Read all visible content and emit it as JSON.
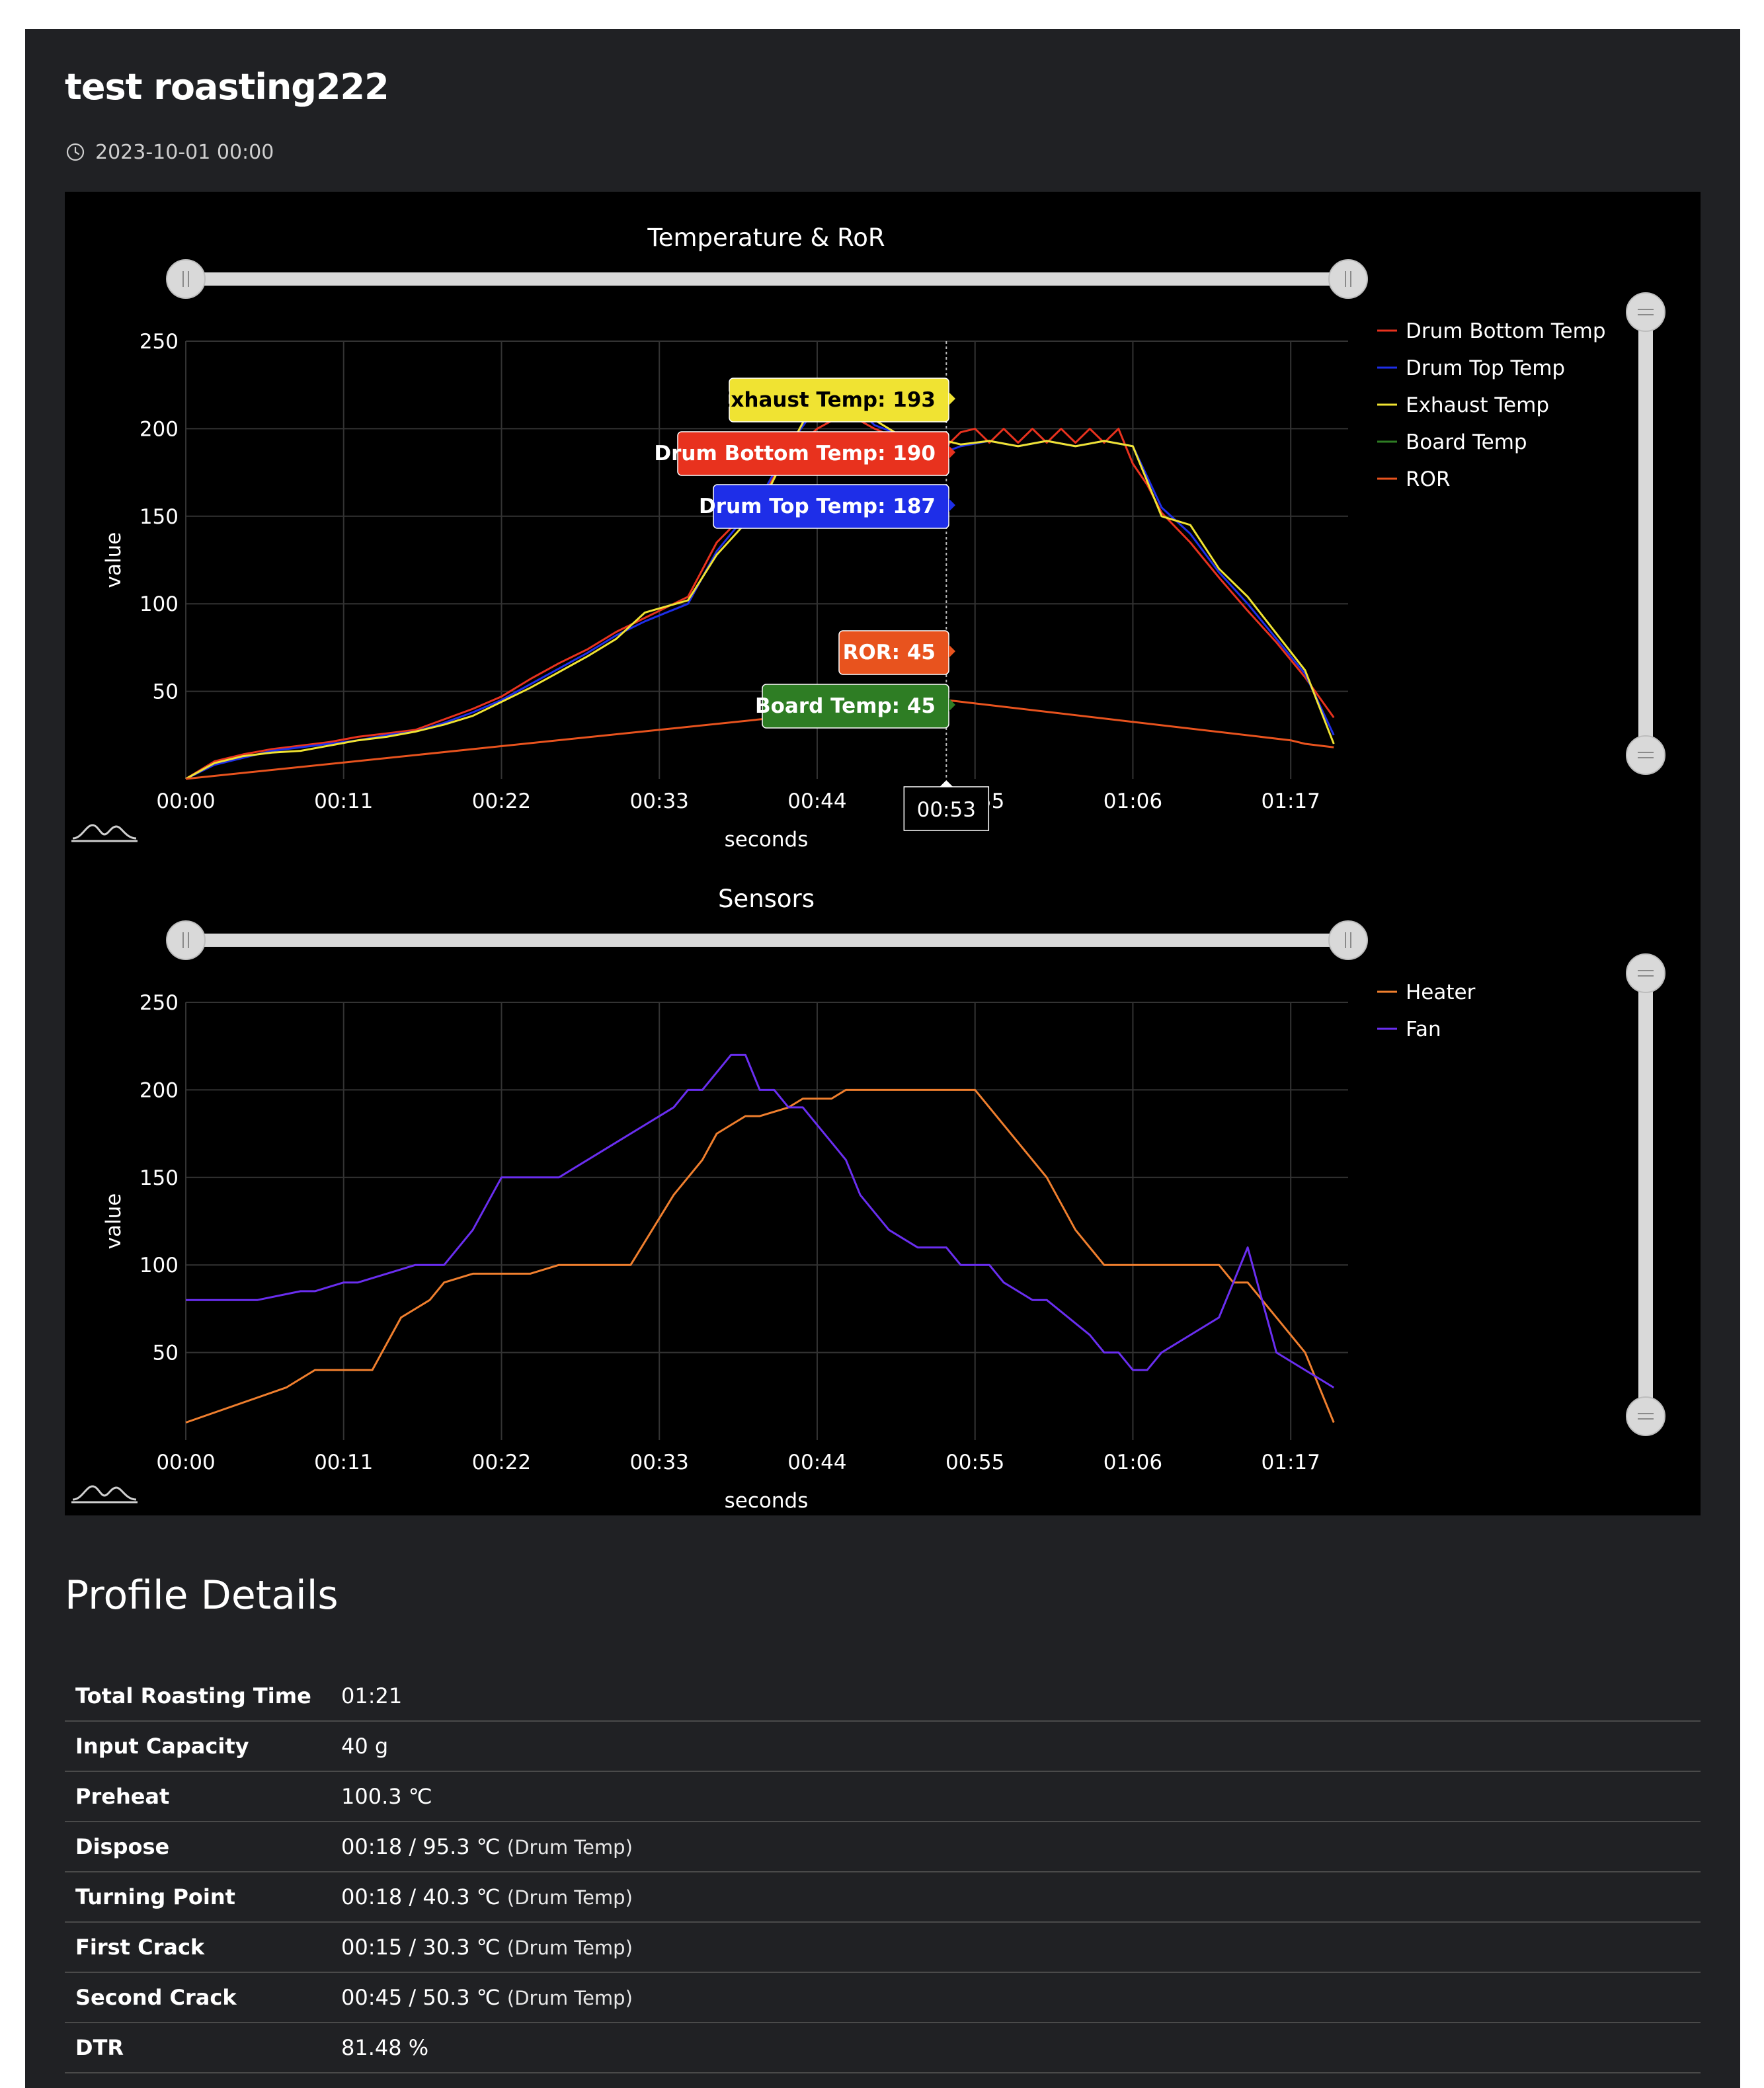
{
  "page": {
    "title": "test roasting222",
    "date": "2023-10-01 00:00",
    "icons": {
      "date": "clock-icon",
      "zoom_reset": "mountain-chart-icon",
      "range_handle": "grip-handle-icon"
    }
  },
  "colors": {
    "page_bg": "#202124",
    "chart_bg": "#000000",
    "grid": "#333333",
    "slider": "#d9d9d9",
    "drum_bottom": "#e8321e",
    "drum_top": "#1e2ee8",
    "exhaust": "#f0e332",
    "board": "#2e7d24",
    "ror": "#e8531e",
    "heater": "#f07f2e",
    "fan": "#6a2ef0"
  },
  "chart_data": [
    {
      "type": "line",
      "title": "Temperature & RoR",
      "xlabel": "seconds",
      "ylabel": "value",
      "xlim": [
        0,
        81
      ],
      "ylim": [
        0,
        250
      ],
      "x_ticks": [
        "00:00",
        "00:11",
        "00:22",
        "00:33",
        "00:44",
        "00:55",
        "01:06",
        "01:17"
      ],
      "y_ticks": [
        "50",
        "100",
        "150",
        "200",
        "250"
      ],
      "grid": true,
      "legend_position": "right",
      "series": [
        {
          "name": "Drum Bottom Temp",
          "color": "#e8321e",
          "x": [
            0,
            2,
            4,
            6,
            8,
            10,
            12,
            14,
            16,
            18,
            20,
            22,
            24,
            26,
            28,
            30,
            32,
            35,
            37,
            40,
            42,
            44,
            46,
            48,
            50,
            52,
            53,
            54,
            55,
            56,
            57,
            58,
            59,
            60,
            61,
            62,
            63,
            64,
            65,
            66,
            67,
            68,
            70,
            72,
            74,
            76,
            78,
            80
          ],
          "y": [
            0,
            10,
            14,
            17,
            19,
            21,
            24,
            26,
            28,
            34,
            40,
            47,
            57,
            66,
            74,
            84,
            92,
            104,
            135,
            160,
            185,
            200,
            209,
            200,
            193,
            190,
            190,
            198,
            200,
            192,
            200,
            192,
            200,
            192,
            200,
            192,
            200,
            192,
            200,
            180,
            168,
            152,
            135,
            115,
            96,
            78,
            58,
            35
          ]
        },
        {
          "name": "Drum Top Temp",
          "color": "#1e2ee8",
          "x": [
            0,
            2,
            4,
            6,
            8,
            10,
            12,
            14,
            16,
            18,
            20,
            22,
            24,
            26,
            28,
            30,
            32,
            35,
            37,
            40,
            42,
            44,
            46,
            48,
            50,
            52,
            53,
            54,
            56,
            58,
            60,
            62,
            64,
            66,
            68,
            70,
            72,
            74,
            76,
            78,
            80
          ],
          "y": [
            0,
            8,
            12,
            16,
            18,
            20,
            22,
            25,
            27,
            32,
            38,
            45,
            54,
            63,
            72,
            82,
            90,
            100,
            130,
            160,
            190,
            213,
            218,
            202,
            196,
            188,
            187,
            190,
            193,
            190,
            193,
            190,
            193,
            190,
            155,
            140,
            118,
            100,
            80,
            60,
            25
          ]
        },
        {
          "name": "Exhaust Temp",
          "color": "#f0e332",
          "x": [
            0,
            2,
            4,
            6,
            8,
            10,
            12,
            14,
            16,
            18,
            20,
            22,
            24,
            26,
            28,
            30,
            32,
            35,
            37,
            40,
            42,
            44,
            46,
            48,
            50,
            52,
            53,
            54,
            56,
            58,
            60,
            62,
            64,
            66,
            68,
            70,
            72,
            74,
            76,
            78,
            80
          ],
          "y": [
            0,
            9,
            13,
            15,
            16,
            19,
            22,
            24,
            27,
            31,
            36,
            44,
            52,
            61,
            70,
            80,
            95,
            102,
            128,
            155,
            188,
            219,
            222,
            205,
            195,
            193,
            193,
            191,
            193,
            190,
            193,
            190,
            193,
            190,
            150,
            145,
            120,
            104,
            83,
            62,
            20
          ]
        },
        {
          "name": "Board Temp",
          "color": "#2e7d24",
          "x": [],
          "y": []
        },
        {
          "name": "ROR",
          "color": "#e8531e",
          "x": [
            0,
            53,
            77,
            78,
            80
          ],
          "y": [
            0,
            45,
            22,
            20,
            18
          ]
        }
      ],
      "hover": {
        "x": "00:53",
        "labels": [
          {
            "text": "Exhaust Temp: 193",
            "bg": "#f0e332",
            "fg": "#000000",
            "y": 193
          },
          {
            "text": "Drum Bottom Temp: 190",
            "bg": "#e8321e",
            "fg": "#ffffff",
            "y": 190
          },
          {
            "text": "Drum Top Temp: 187",
            "bg": "#1e2ee8",
            "fg": "#ffffff",
            "y": 187
          },
          {
            "text": "ROR: 45",
            "bg": "#e8531e",
            "fg": "#ffffff",
            "y": 45
          },
          {
            "text": "Board Temp: 45",
            "bg": "#2e7d24",
            "fg": "#ffffff",
            "y": 45
          }
        ]
      }
    },
    {
      "type": "line",
      "title": "Sensors",
      "xlabel": "seconds",
      "ylabel": "value",
      "xlim": [
        0,
        81
      ],
      "ylim": [
        0,
        250
      ],
      "x_ticks": [
        "00:00",
        "00:11",
        "00:22",
        "00:33",
        "00:44",
        "00:55",
        "01:06",
        "01:17"
      ],
      "y_ticks": [
        "50",
        "100",
        "150",
        "200",
        "250"
      ],
      "grid": true,
      "legend_position": "right",
      "series": [
        {
          "name": "Heater",
          "color": "#f07f2e",
          "x": [
            0,
            7,
            9,
            13,
            15,
            17,
            18,
            20,
            22,
            24,
            26,
            28,
            30,
            31,
            34,
            36,
            37,
            39,
            40,
            42,
            43,
            45,
            46,
            48,
            50,
            52,
            54,
            55,
            57,
            60,
            62,
            64,
            66,
            68,
            72,
            73,
            74,
            76,
            78,
            80
          ],
          "y": [
            10,
            30,
            40,
            40,
            70,
            80,
            90,
            95,
            95,
            95,
            100,
            100,
            100,
            100,
            140,
            160,
            175,
            185,
            185,
            190,
            195,
            195,
            200,
            200,
            200,
            200,
            200,
            200,
            180,
            150,
            120,
            100,
            100,
            100,
            100,
            90,
            90,
            70,
            50,
            10
          ]
        },
        {
          "name": "Fan",
          "color": "#6a2ef0",
          "x": [
            0,
            4,
            5,
            8,
            9,
            11,
            12,
            14,
            16,
            18,
            20,
            22,
            24,
            26,
            28,
            30,
            32,
            34,
            35,
            36,
            37,
            38,
            39,
            40,
            41,
            42,
            43,
            44,
            45,
            46,
            47,
            48,
            49,
            51,
            53,
            54,
            55,
            56,
            57,
            59,
            60,
            63,
            64,
            65,
            66,
            67,
            68,
            70,
            72,
            74,
            76,
            78,
            80
          ],
          "y": [
            80,
            80,
            80,
            85,
            85,
            90,
            90,
            95,
            100,
            100,
            120,
            150,
            150,
            150,
            160,
            170,
            180,
            190,
            200,
            200,
            210,
            220,
            220,
            200,
            200,
            190,
            190,
            180,
            170,
            160,
            140,
            130,
            120,
            110,
            110,
            100,
            100,
            100,
            90,
            80,
            80,
            60,
            50,
            50,
            40,
            40,
            50,
            60,
            70,
            110,
            50,
            40,
            30
          ]
        }
      ]
    }
  ],
  "details": {
    "heading": "Profile Details",
    "rows": [
      {
        "label": "Total Roasting Time",
        "value": "01:21",
        "note": ""
      },
      {
        "label": "Input Capacity",
        "value": "40 g",
        "note": ""
      },
      {
        "label": "Preheat",
        "value": "100.3 ℃",
        "note": ""
      },
      {
        "label": "Dispose",
        "value": "00:18 / 95.3 ℃",
        "note": "(Drum Temp)"
      },
      {
        "label": "Turning Point",
        "value": "00:18 / 40.3 ℃",
        "note": "(Drum Temp)"
      },
      {
        "label": "First Crack",
        "value": "00:15 / 30.3 ℃",
        "note": "(Drum Temp)"
      },
      {
        "label": "Second Crack",
        "value": "00:45 / 50.3 ℃",
        "note": "(Drum Temp)"
      },
      {
        "label": "DTR",
        "value": "81.48 %",
        "note": ""
      }
    ]
  }
}
